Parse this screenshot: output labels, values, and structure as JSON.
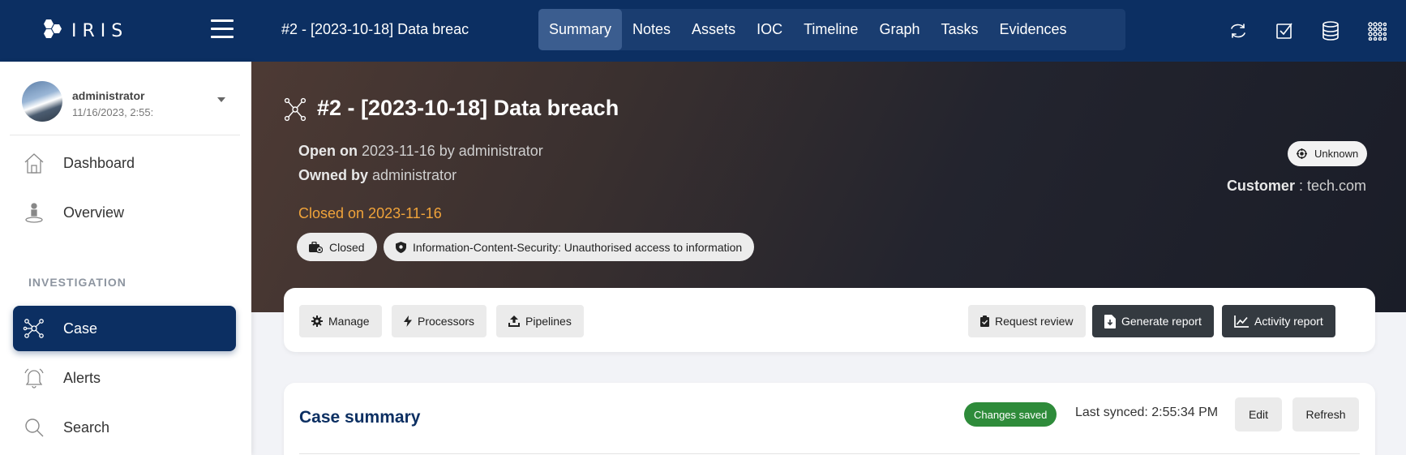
{
  "brand": {
    "logo_text": "IRIS",
    "accent": "#0c2f62"
  },
  "topbar": {
    "case_name": "#2 - [2023-10-18] Data breac",
    "tabs": [
      {
        "label": "Summary",
        "active": true
      },
      {
        "label": "Notes"
      },
      {
        "label": "Assets"
      },
      {
        "label": "IOC"
      },
      {
        "label": "Timeline"
      },
      {
        "label": "Graph"
      },
      {
        "label": "Tasks"
      },
      {
        "label": "Evidences"
      }
    ],
    "icons": [
      "refresh-icon",
      "checkbox-icon",
      "database-icon",
      "apps-grid-icon"
    ]
  },
  "sidebar": {
    "user": {
      "name": "administrator",
      "date": "11/16/2023, 2:55:"
    },
    "items": [
      {
        "label": "Dashboard",
        "icon": "home-icon"
      },
      {
        "label": "Overview",
        "icon": "person-pin-icon"
      }
    ],
    "section": "INVESTIGATION",
    "investigation_items": [
      {
        "label": "Case",
        "icon": "network-icon",
        "active": true
      },
      {
        "label": "Alerts",
        "icon": "bell-icon"
      },
      {
        "label": "Search",
        "icon": "search-icon"
      }
    ]
  },
  "case": {
    "title": "#2 - [2023-10-18] Data breach",
    "open_label": "Open on",
    "open_value": "2023-11-16 by administrator",
    "owned_label": "Owned by",
    "owned_value": "administrator",
    "closed_text": "Closed on 2023-11-16",
    "state_pill": "Closed",
    "classification_pill": "Information-Content-Security: Unauthorised access to information",
    "severity_badge": "Unknown",
    "customer_label": "Customer",
    "customer_value": "tech.com",
    "closed_color": "#f0a33a"
  },
  "actions": {
    "manage": "Manage",
    "processors": "Processors",
    "pipelines": "Pipelines",
    "request_review": "Request review",
    "generate_report": "Generate report",
    "activity_report": "Activity report"
  },
  "summary": {
    "title": "Case summary",
    "status_badge": "Changes saved",
    "last_synced": "Last synced: 2:55:34 PM",
    "edit": "Edit",
    "refresh": "Refresh",
    "status_color": "#2e8b3a"
  }
}
